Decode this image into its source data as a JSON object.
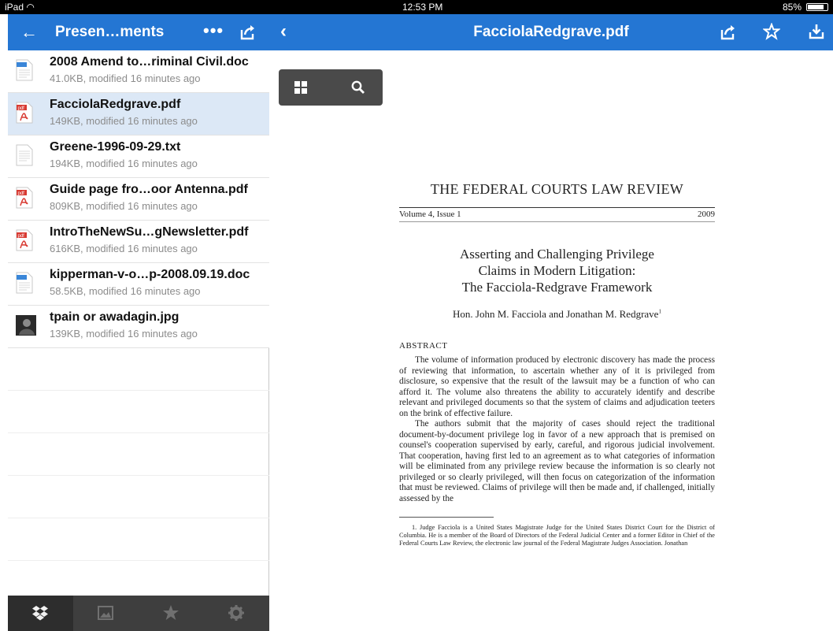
{
  "status_bar": {
    "device": "iPad",
    "time": "12:53 PM",
    "battery": "85%",
    "battery_level": 0.85
  },
  "sidebar": {
    "title": "Presen…ments",
    "files": [
      {
        "name": "2008 Amend to…riminal Civil.doc",
        "meta": "41.0KB, modified 16 minutes ago",
        "icon": "doc-icon"
      },
      {
        "name": "FacciolaRedgrave.pdf",
        "meta": "149KB, modified 16 minutes ago",
        "icon": "pdf-icon"
      },
      {
        "name": "Greene-1996-09-29.txt",
        "meta": "194KB, modified 16 minutes ago",
        "icon": "txt-icon"
      },
      {
        "name": "Guide page fro…oor Antenna.pdf",
        "meta": "809KB, modified 16 minutes ago",
        "icon": "pdf-icon"
      },
      {
        "name": "IntroTheNewSu…gNewsletter.pdf",
        "meta": "616KB, modified 16 minutes ago",
        "icon": "pdf-icon"
      },
      {
        "name": "kipperman-v-o…p-2008.09.19.doc",
        "meta": "58.5KB, modified 16 minutes ago",
        "icon": "doc-icon"
      },
      {
        "name": "tpain or awadagin.jpg",
        "meta": "139KB, modified 16 minutes ago",
        "icon": "image-thumb-icon"
      }
    ],
    "selected_index": 1,
    "tabs": [
      "dropbox-icon",
      "photos-icon",
      "favorites-star-icon",
      "settings-gear-icon"
    ]
  },
  "viewer": {
    "title": "FacciolaRedgrave.pdf",
    "document": {
      "journal": "THE FEDERAL COURTS LAW REVIEW",
      "issue": "Volume 4, Issue 1",
      "year": "2009",
      "title_lines": [
        "Asserting and Challenging Privilege",
        "Claims in Modern Litigation:",
        "The Facciola-Redgrave Framework"
      ],
      "authors": "Hon. John M. Facciola and Jonathan M. Redgrave",
      "author_mark": "1",
      "abstract_heading": "ABSTRACT",
      "paragraphs": [
        "The volume of information produced by electronic discovery has made the process of reviewing that information, to ascertain whether any of it is privileged from disclosure, so expensive that the result of the lawsuit may be a function of who can afford it. The volume also threatens the ability to accurately identify and describe relevant and privileged documents so that the system of claims and adjudication teeters on the brink of effective failure.",
        "The authors submit that the majority of cases should reject the traditional document-by-document privilege log in favor of a new approach that is premised on counsel's cooperation supervised by early, careful, and rigorous judicial involvement. That cooperation, having first led to an agreement as to what categories of information will be eliminated from any privilege review because the information is so clearly not privileged or so clearly privileged, will then focus on categorization of the information that must be reviewed. Claims of privilege will then be made and, if challenged, initially assessed by the"
      ],
      "footnote": "1. Judge Facciola is a United States Magistrate Judge for the United States District Court for the District of Columbia. He is a member of the Board of Directors of the Federal Judicial Center and a former Editor in Chief of the Federal Courts Law Review, the electronic law journal of the Federal Magistrate Judges Association. Jonathan"
    }
  }
}
